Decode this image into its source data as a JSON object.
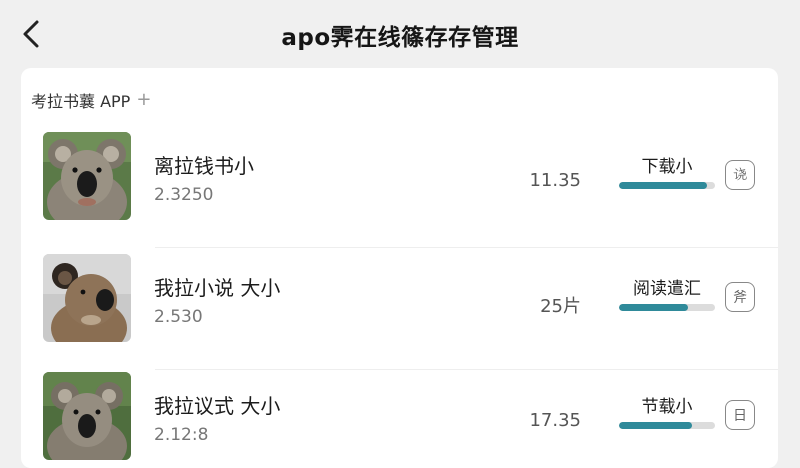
{
  "header": {
    "back_icon": "chevron-left-icon",
    "title": "apo霁在线篠存存管理"
  },
  "section": {
    "title": "考拉书蘘 APP",
    "add_symbol": "+"
  },
  "apps": [
    {
      "name": "离拉钱书小",
      "version": "2.3250",
      "size": "11.35",
      "status": "下载小",
      "progress": 0.92,
      "action_glyph": "𫍢"
    },
    {
      "name": "我拉小说 大小",
      "version": "2.530",
      "size": "25⽚",
      "status": "阅读遣汇",
      "progress": 0.72,
      "action_glyph": "斧"
    },
    {
      "name": "我拉议式 大小",
      "version": "2.12:8",
      "size": "17.35",
      "status": "节载小",
      "progress": 0.76,
      "action_glyph": "日"
    }
  ],
  "colors": {
    "background": "#f0f0f0",
    "card": "#ffffff",
    "progress_fill": "#2f8a9a",
    "progress_track": "#dcdcdc"
  }
}
